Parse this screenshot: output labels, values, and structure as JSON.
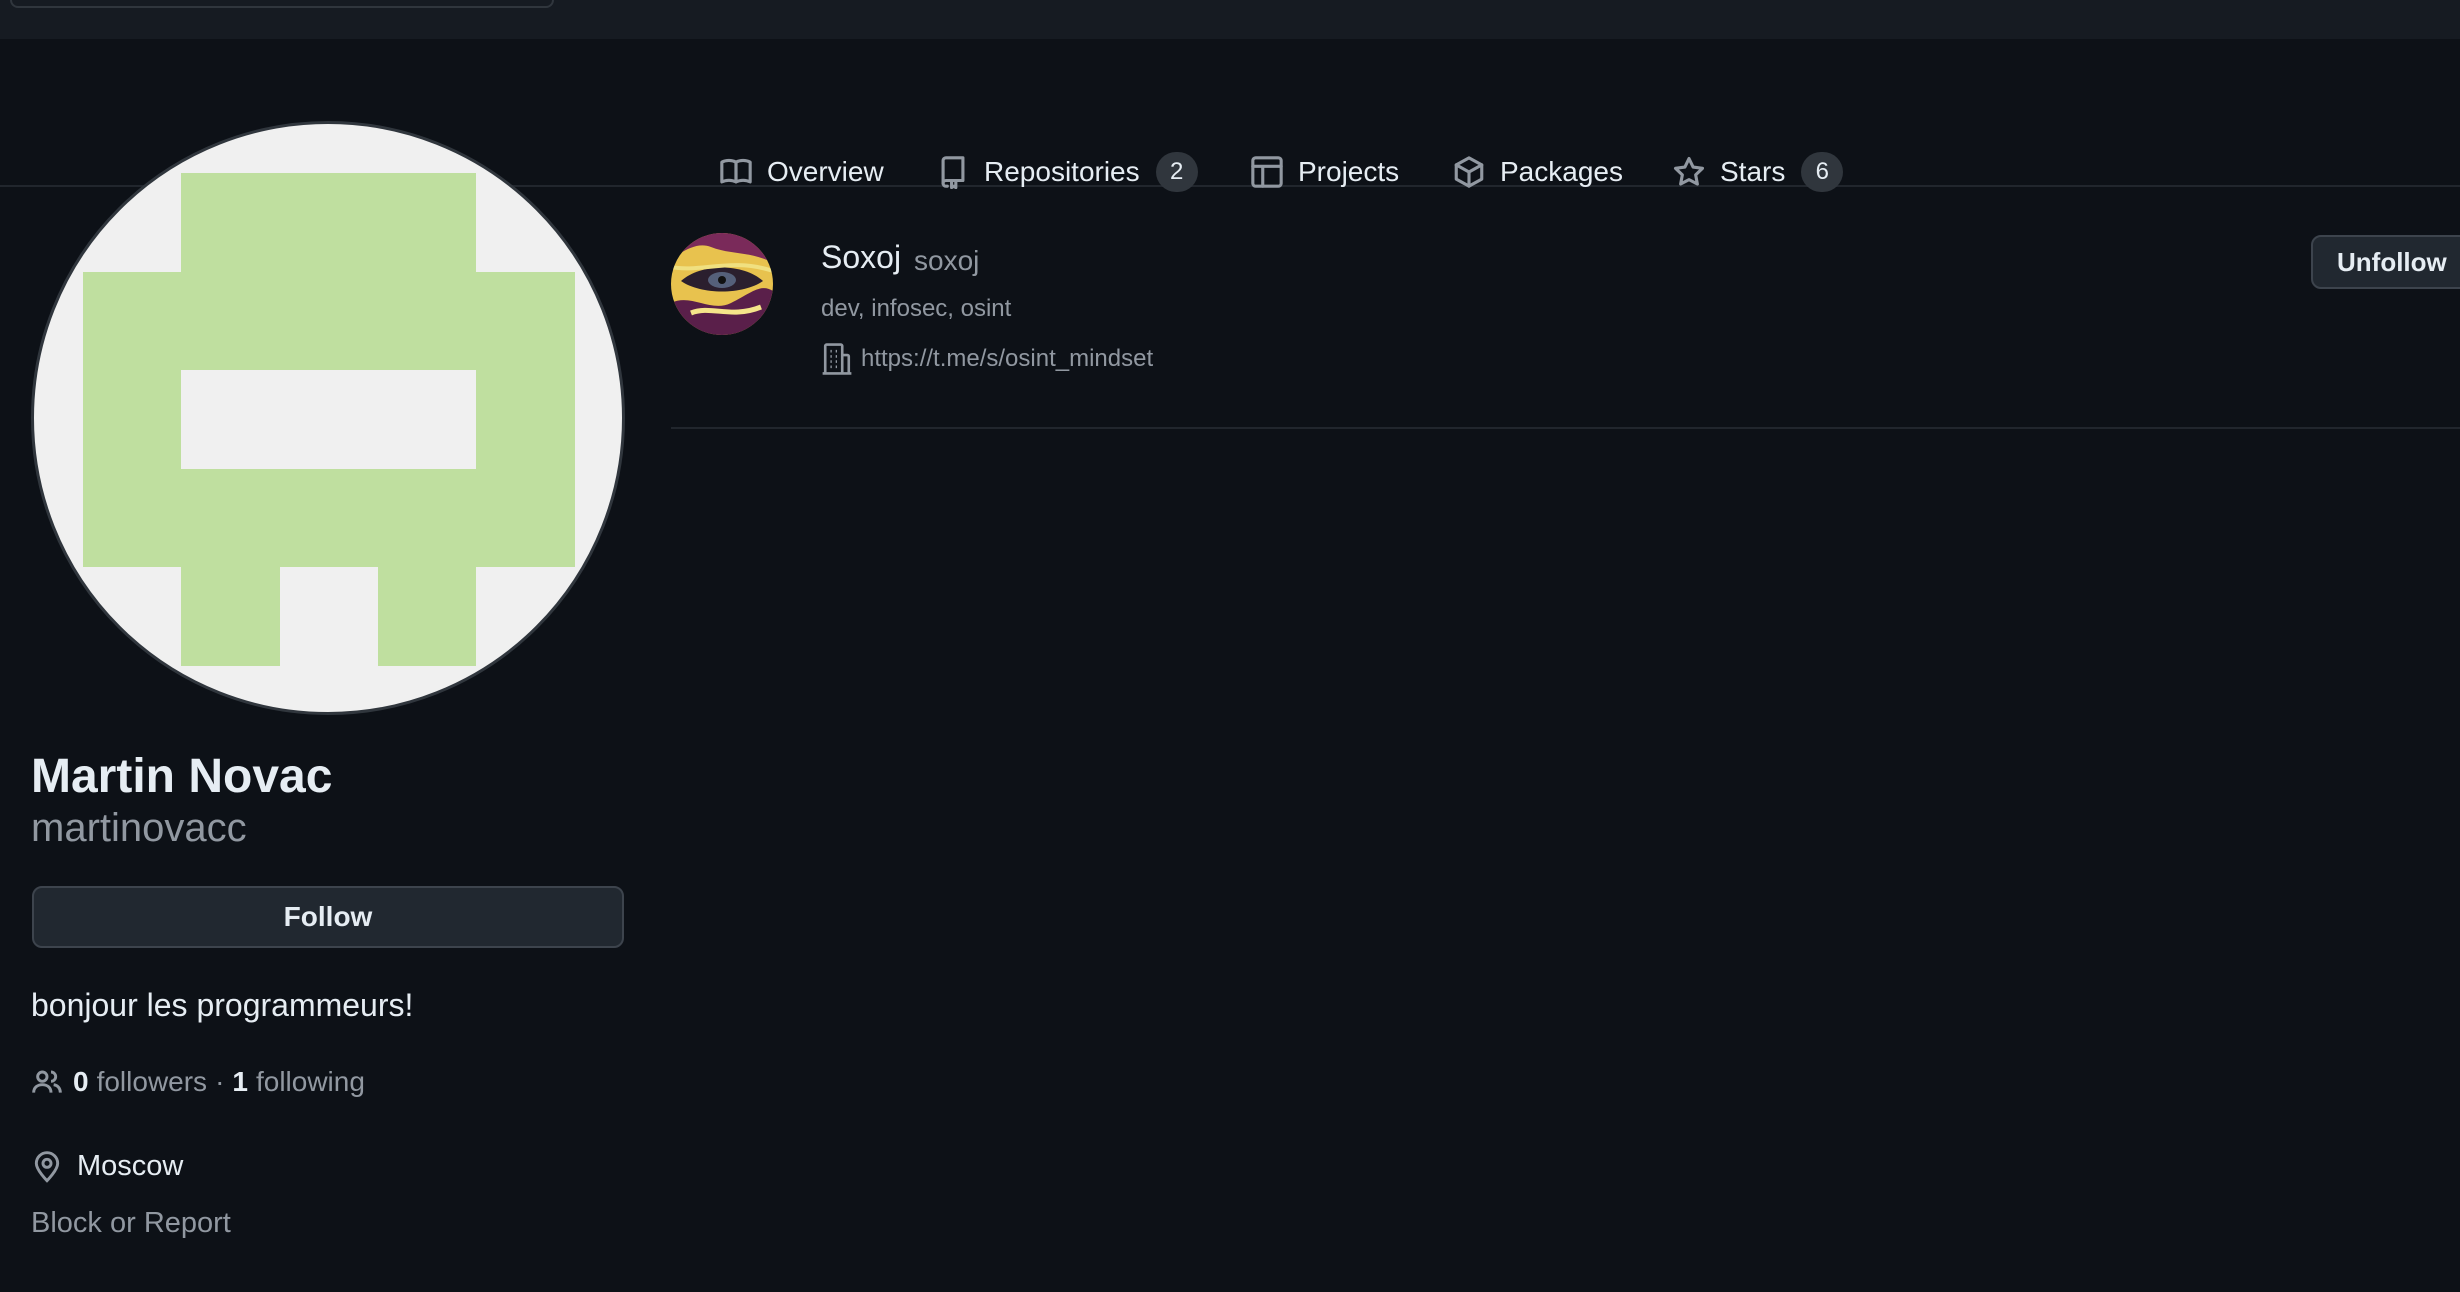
{
  "tabs": [
    {
      "label": "Overview",
      "icon": "book-icon"
    },
    {
      "label": "Repositories",
      "icon": "repo-icon",
      "count": "2"
    },
    {
      "label": "Projects",
      "icon": "table-icon"
    },
    {
      "label": "Packages",
      "icon": "package-icon"
    },
    {
      "label": "Stars",
      "icon": "star-icon",
      "count": "6"
    }
  ],
  "profile": {
    "name": "Martin Novac",
    "login": "martinovacc",
    "follow_label": "Follow",
    "bio": "bonjour les programmeurs!",
    "followers_count": "0",
    "followers_label": "followers",
    "separator": "·",
    "following_count": "1",
    "following_label": "following",
    "location": "Moscow",
    "block_label": "Block or Report",
    "identicon_color": "#bfdf9f"
  },
  "following_list": [
    {
      "name": "Soxoj",
      "login": "soxoj",
      "bio": "dev, infosec, osint",
      "company": "https://t.me/s/osint_mindset",
      "button_label": "Unfollow"
    }
  ],
  "colors": {
    "background": "#0d1117",
    "header": "#161b22",
    "muted_text": "#9198a1",
    "text": "#e6edf3",
    "border": "#30363d"
  }
}
